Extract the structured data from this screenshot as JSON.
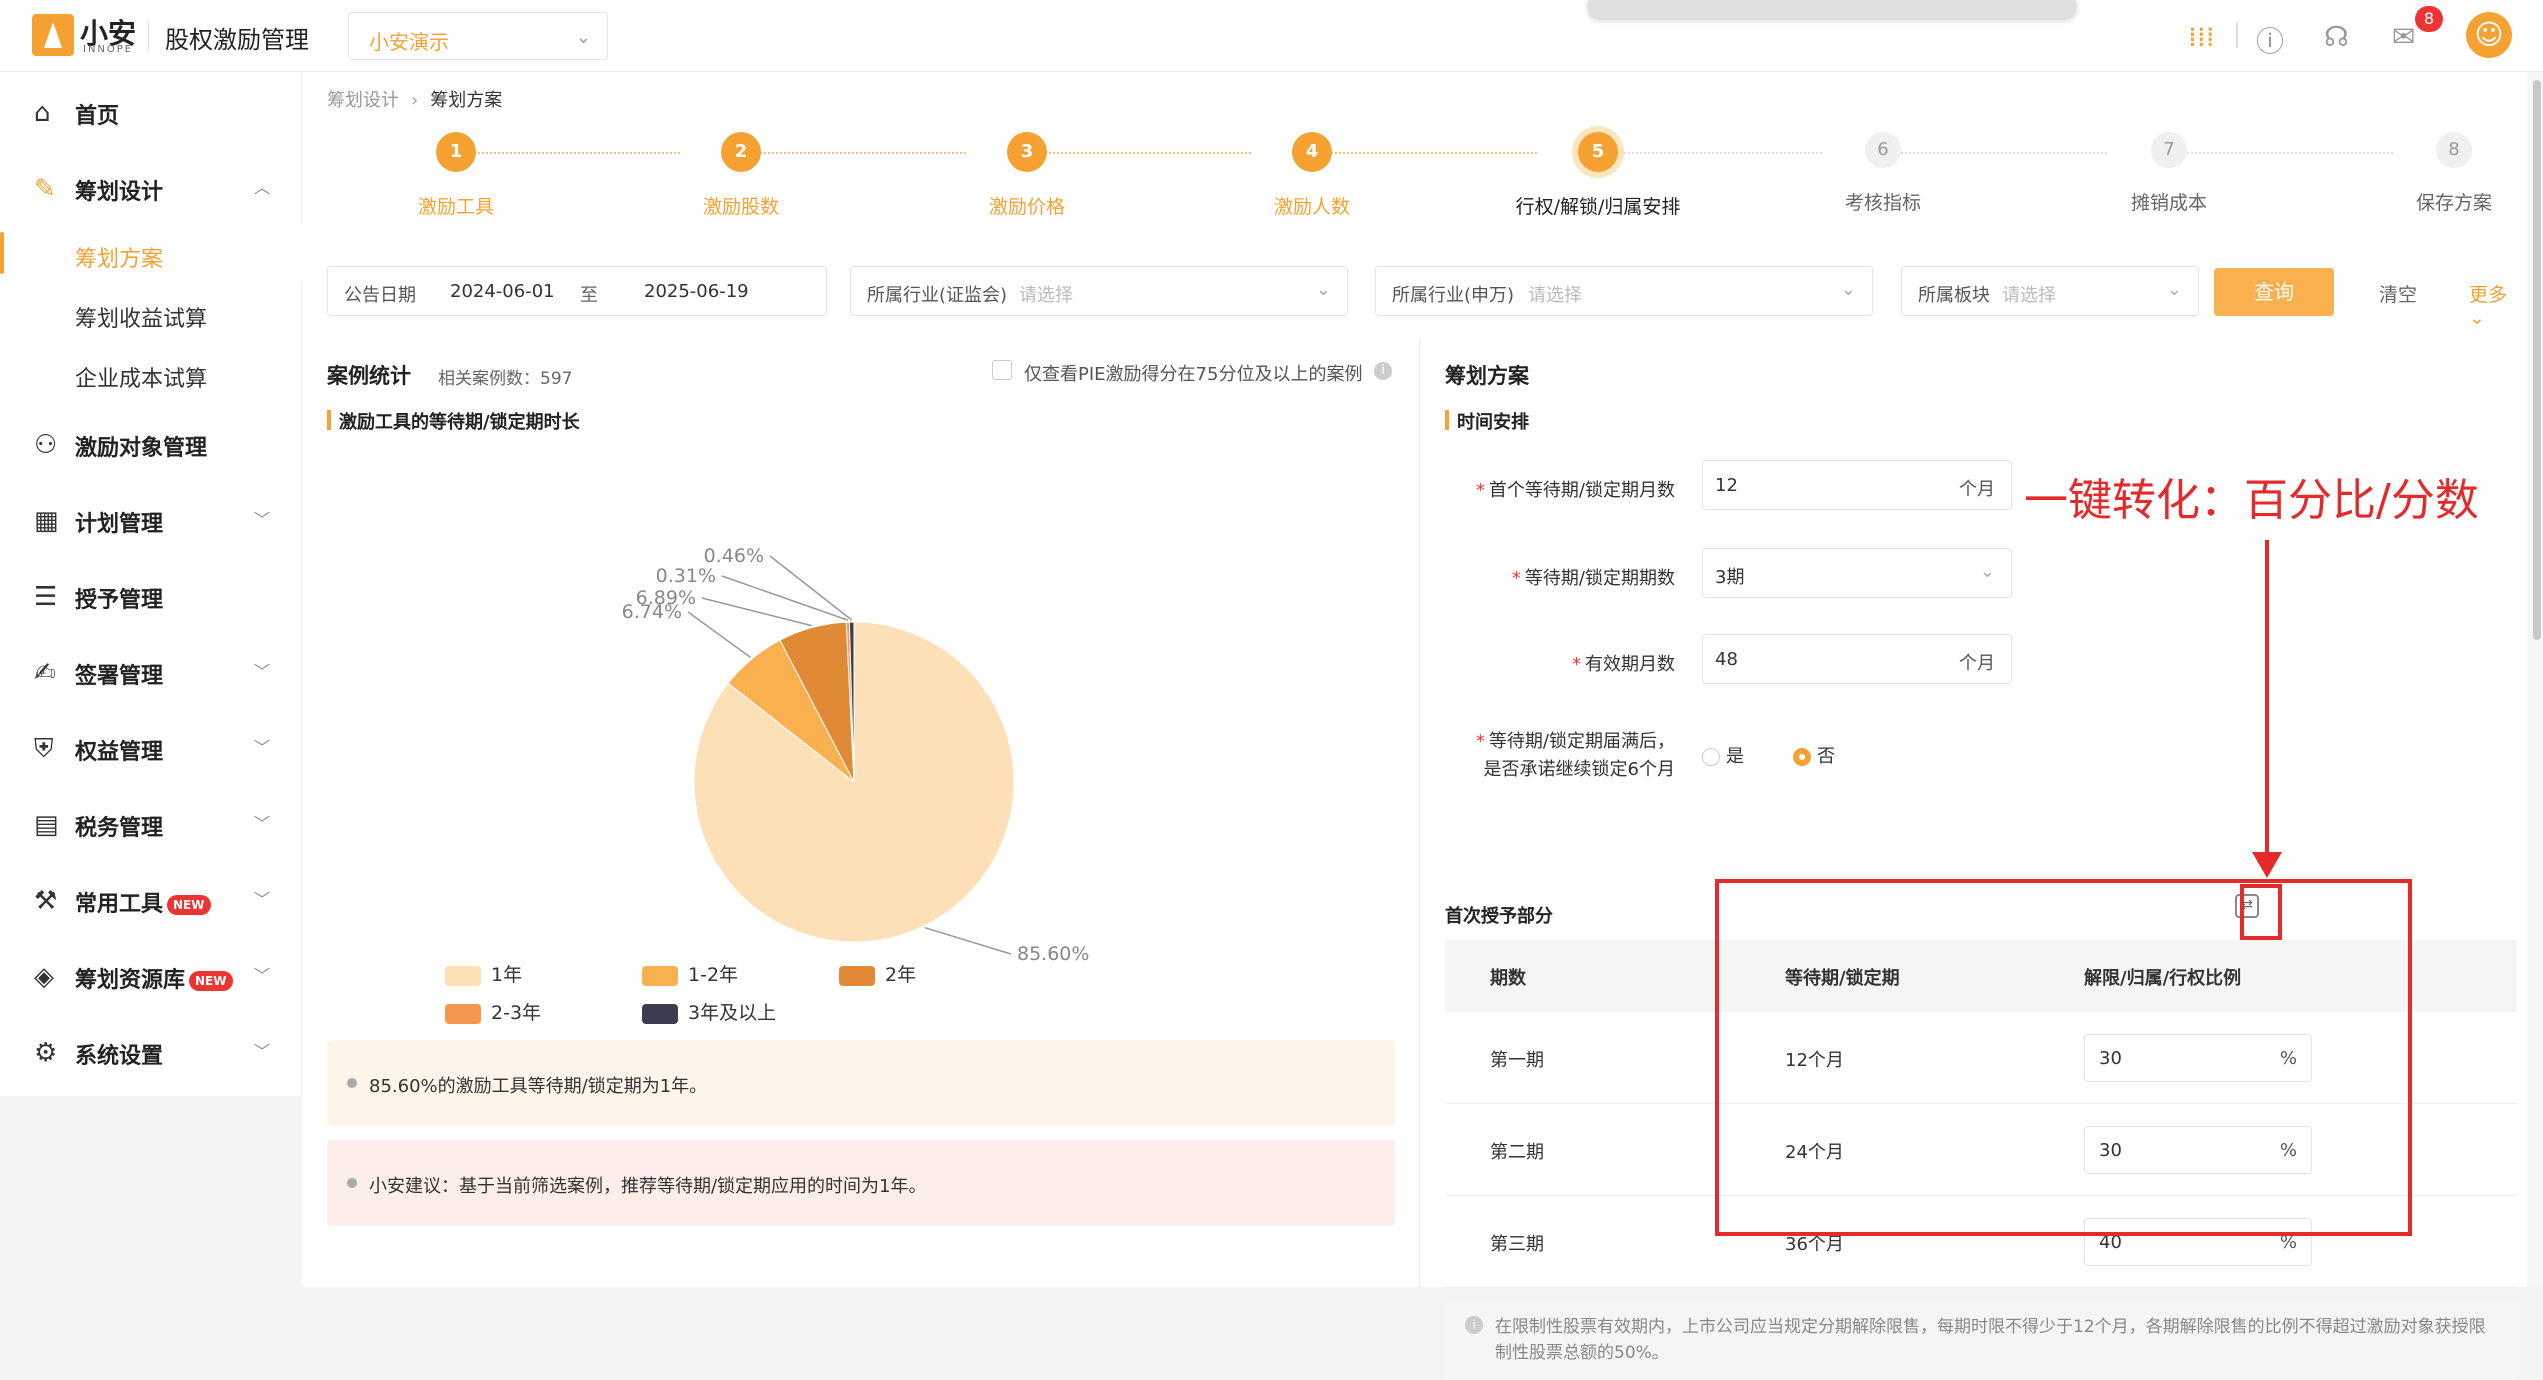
{
  "header": {
    "logo_text": "小安",
    "logo_sub": "INNOPE",
    "system_title": "股权激励管理",
    "tenant": "小安演示",
    "notification_count": "8"
  },
  "sidebar": {
    "items": [
      {
        "label": "首页",
        "icon": "home-icon"
      },
      {
        "label": "筹划设计",
        "icon": "edit-icon",
        "expanded": true
      },
      {
        "label": "激励对象管理",
        "icon": "users-icon"
      },
      {
        "label": "计划管理",
        "icon": "grid-icon"
      },
      {
        "label": "授予管理",
        "icon": "list-icon"
      },
      {
        "label": "签署管理",
        "icon": "sign-icon"
      },
      {
        "label": "权益管理",
        "icon": "shield-icon"
      },
      {
        "label": "税务管理",
        "icon": "tax-icon"
      },
      {
        "label": "常用工具",
        "icon": "toolbox-icon",
        "badge": "NEW"
      },
      {
        "label": "筹划资源库",
        "icon": "layers-icon",
        "badge": "NEW"
      },
      {
        "label": "系统设置",
        "icon": "settings-icon"
      }
    ],
    "sub_items": [
      {
        "label": "筹划方案",
        "current": true
      },
      {
        "label": "筹划收益试算"
      },
      {
        "label": "企业成本试算"
      }
    ]
  },
  "breadcrumb": {
    "parent": "筹划设计",
    "current": "筹划方案"
  },
  "steps": [
    {
      "num": "1",
      "label": "激励工具",
      "state": "done"
    },
    {
      "num": "2",
      "label": "激励股数",
      "state": "done"
    },
    {
      "num": "3",
      "label": "激励价格",
      "state": "done"
    },
    {
      "num": "4",
      "label": "激励人数",
      "state": "done"
    },
    {
      "num": "5",
      "label": "行权/解锁/归属安排",
      "state": "current"
    },
    {
      "num": "6",
      "label": "考核指标",
      "state": "todo"
    },
    {
      "num": "7",
      "label": "摊销成本",
      "state": "todo"
    },
    {
      "num": "8",
      "label": "保存方案",
      "state": "todo"
    }
  ],
  "filters": {
    "date_label": "公告日期",
    "date_from": "2024-06-01",
    "date_to_label": "至",
    "date_to": "2025-06-19",
    "industry_csrc_label": "所属行业(证监会)",
    "industry_sw_label": "所属行业(申万)",
    "board_label": "所属板块",
    "placeholder": "请选择",
    "query": "查询",
    "clear": "清空",
    "more": "更多"
  },
  "stats": {
    "title": "案例统计",
    "count_label": "相关案例数：597",
    "pie_filter_label": "仅查看PIE激励得分在75分位及以上的案例",
    "chart_title": "激励工具的等待期/锁定期时长",
    "note1": "85.60%的激励工具等待期/锁定期为1年。",
    "note2": "小安建议：基于当前筛选案例，推荐等待期/锁定期应用的时间为1年。"
  },
  "chart_data": {
    "type": "pie",
    "title": "激励工具的等待期/锁定期时长",
    "slices": [
      {
        "name": "1年",
        "value": 85.6,
        "label": "85.60%",
        "color": "#fde0b8"
      },
      {
        "name": "1-2年",
        "value": 6.74,
        "label": "6.74%",
        "color": "#f9b04e"
      },
      {
        "name": "2年",
        "value": 6.89,
        "label": "6.89%",
        "color": "#e08a35"
      },
      {
        "name": "2-3年",
        "value": 0.31,
        "label": "0.31%",
        "color": "#f5964f"
      },
      {
        "name": "3年及以上",
        "value": 0.46,
        "label": "0.46%",
        "color": "#3d3d52"
      }
    ],
    "legend_position": "bottom"
  },
  "plan": {
    "title": "筹划方案",
    "section": "时间安排",
    "first_wait_label": "首个等待期/锁定期月数",
    "first_wait_value": "12",
    "unit_month": "个月",
    "periods_label": "等待期/锁定期期数",
    "periods_value": "3期",
    "valid_label": "有效期月数",
    "valid_value": "48",
    "promise_label_1": "等待期/锁定期届满后，",
    "promise_label_2": "是否承诺继续锁定6个月",
    "yes": "是",
    "no": "否",
    "first_grant_title": "首次授予部分",
    "table": {
      "headers": [
        "期数",
        "等待期/锁定期",
        "解限/归属/行权比例"
      ],
      "rows": [
        {
          "period": "第一期",
          "wait": "12个月",
          "ratio": "30"
        },
        {
          "period": "第二期",
          "wait": "24个月",
          "ratio": "30"
        },
        {
          "period": "第三期",
          "wait": "36个月",
          "ratio": "40"
        }
      ],
      "unit": "%"
    },
    "hint": "在限制性股票有效期内，上市公司应当规定分期解除限售，每期时限不得少于12个月，各期解除限售的比例不得超过激励对象获授限制性股票总额的50%。"
  },
  "annotation": {
    "text": "一键转化：百分比/分数",
    "color": "#e42a2a"
  }
}
